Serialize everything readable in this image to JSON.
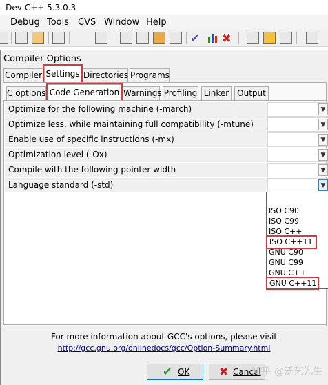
{
  "window": {
    "title": "- Dev-C++ 5.3.0.3"
  },
  "menu": [
    "Debug",
    "Tools",
    "CVS",
    "Window",
    "Help"
  ],
  "dialog": {
    "title": "Compiler Options",
    "top_tabs": [
      "Compiler",
      "Settings",
      "Directories",
      "Programs"
    ],
    "sub_tabs": [
      "C options",
      "Code Generation",
      "Warnings",
      "Profiling",
      "Linker",
      "Output"
    ],
    "options": [
      "Optimize for the following machine (-march)",
      "Optimize less, while maintaining full compatibility (-mtune)",
      "Enable use of specific instructions (-mx)",
      "Optimization level (-Ox)",
      "Compile with the following pointer width",
      "Language standard (-std)"
    ],
    "dropdown_options": [
      "ISO C90",
      "ISO C99",
      "ISO C++",
      "ISO C++11",
      "GNU C90",
      "GNU C99",
      "GNU C++",
      "GNU C++11"
    ],
    "info_text": "For more information about GCC's options, please visit",
    "link_text": "http://gcc.gnu.org/onlinedocs/gcc/Option-Summary.html",
    "ok_label": "OK",
    "cancel_label": "Cancel"
  },
  "watermark": "知乎 @泛艺先生",
  "highlight_color": "#d9363e",
  "icons": [
    "new-file-icon",
    "save-icon",
    "compile-icon",
    "run-icon",
    "check-icon",
    "chart-icon",
    "delete-icon",
    "close-icon"
  ]
}
